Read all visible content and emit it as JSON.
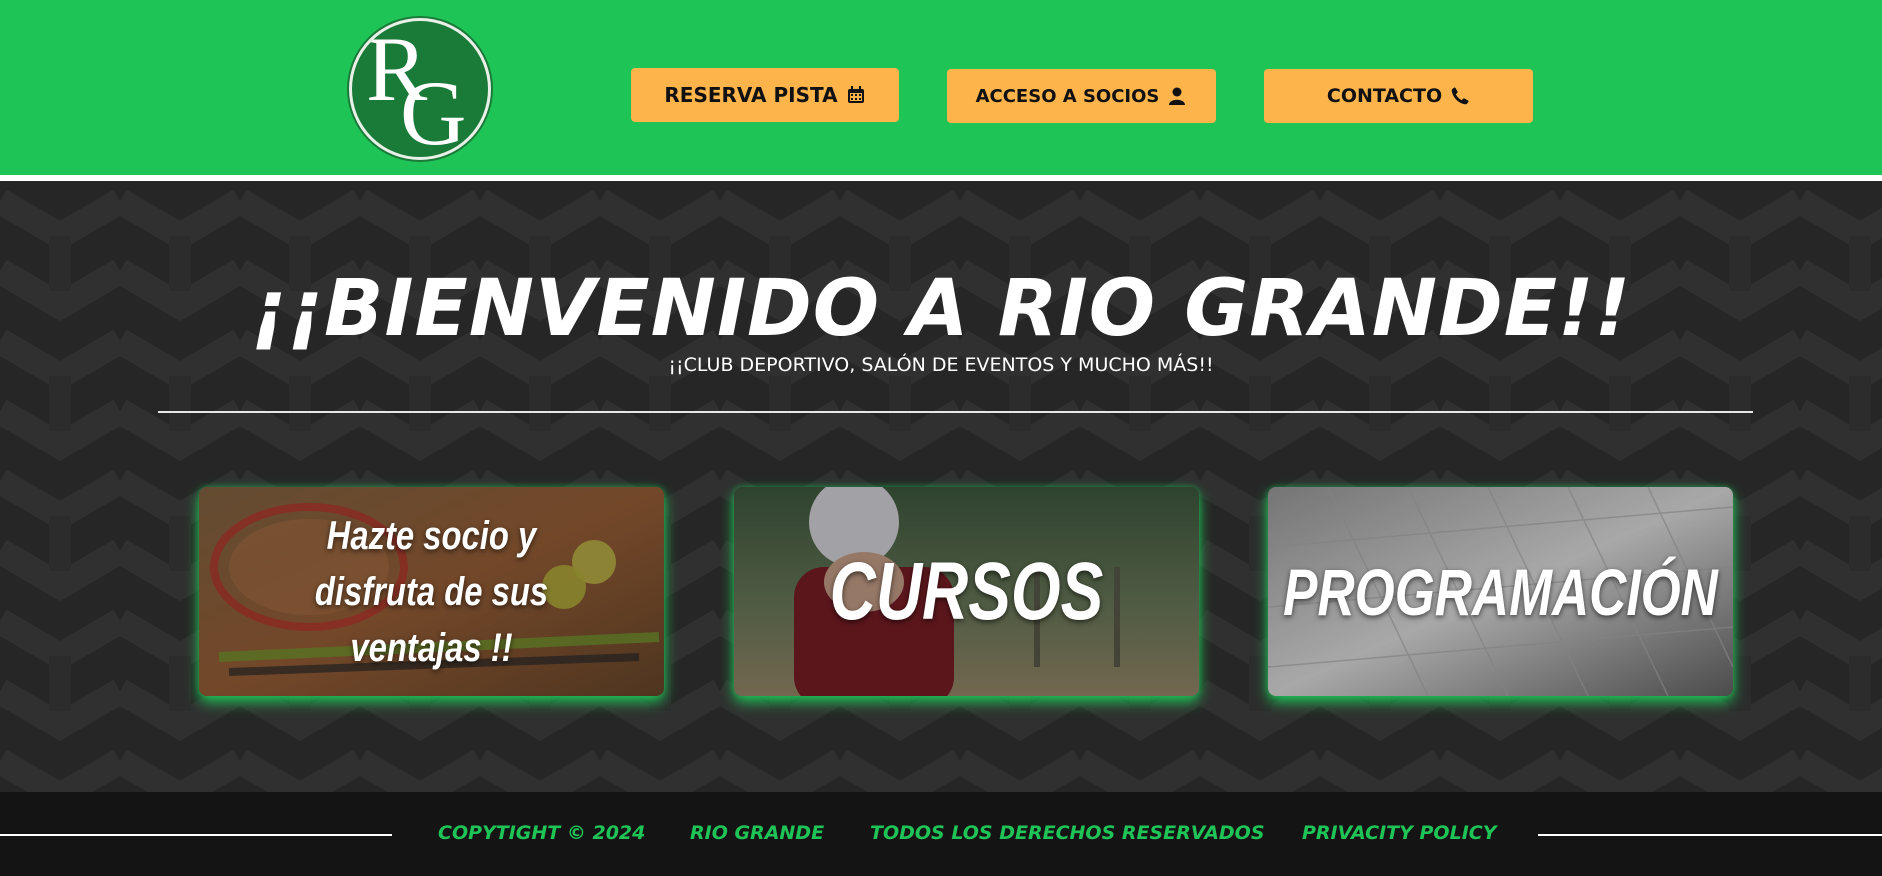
{
  "header": {
    "logo_text": "RG",
    "buttons": {
      "reserva": "RESERVA PISTA",
      "acceso": "ACCESO A SOCIOS",
      "contacto": "CONTACTO"
    }
  },
  "hero": {
    "title": "¡¡BIENVENIDO A RIO GRANDE!!",
    "subtitle": "¡¡CLUB DEPORTIVO, SALÓN DE EVENTOS Y MUCHO MÁS!!"
  },
  "cards": [
    {
      "label_lines": [
        "Hazte socio y",
        "disfruta de sus",
        "ventajas !!"
      ],
      "image": "tennis-rackets"
    },
    {
      "label": "CURSOS",
      "image": "child-football"
    },
    {
      "label": "PROGRAMACIÓN",
      "image": "calendar"
    }
  ],
  "footer": {
    "copyright": "COPYTIGHT © 2024",
    "name": "RIO GRANDE",
    "rights": "TODOS LOS DERECHOS RESERVADOS",
    "privacy": "PRIVACITY POLICY"
  },
  "colors": {
    "header_green": "#1fc457",
    "button_orange": "#fdb44b",
    "dark_bg": "#262626",
    "footer_bg": "#141414",
    "footer_text_green": "#1fc457"
  },
  "icons": {
    "reserva": "calendar-icon",
    "acceso": "user-icon",
    "contacto": "phone-icon"
  }
}
